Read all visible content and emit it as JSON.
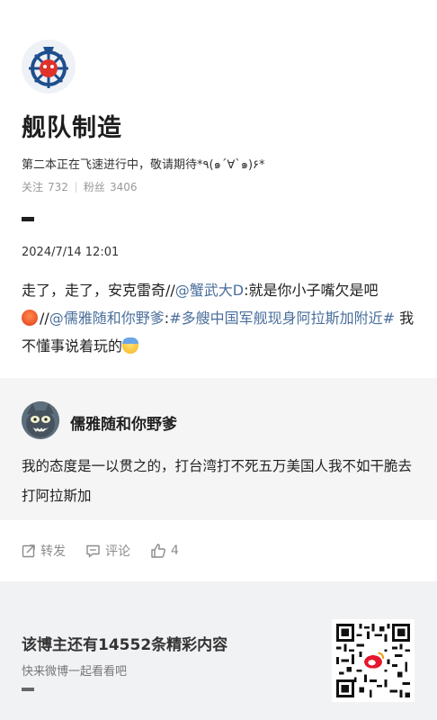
{
  "profile": {
    "name": "舰队制造",
    "bio": "第二本正在飞速进行中，敬请期待*٩(๑´∀`๑)۶*",
    "follow_label": "关注",
    "follow_count": "732",
    "fans_label": "粉丝",
    "fans_count": "3406"
  },
  "post": {
    "time": "2024/7/14 12:01",
    "text_1": "走了，走了，安克雷奇//",
    "mention_1": "@蟹武大D",
    "text_2": ":就是你小子嘴欠是吧",
    "text_3": "//",
    "mention_2": "@儒雅随和你野爹",
    "text_4": ":",
    "hashtag": "#多艘中国军舰现身阿拉斯加附近#",
    "text_5": " 我不懂事说着玩的",
    "emoji_1": "angry-face",
    "emoji_2": "anxious-face"
  },
  "repost": {
    "name": "儒雅随和你野爹",
    "text": "我的态度是一以贯之的，打台湾打不死五万美国人我不如干脆去打阿拉斯加"
  },
  "actions": {
    "forward_label": "转发",
    "comment_label": "评论",
    "like_count": "4"
  },
  "promo": {
    "title": "该博主还有14552条精彩内容",
    "subtitle": "快来微博一起看看吧"
  },
  "colors": {
    "link": "#4a6f9c",
    "repost_bg": "#f5f5f5",
    "footer_bg": "#f1f2f4"
  }
}
